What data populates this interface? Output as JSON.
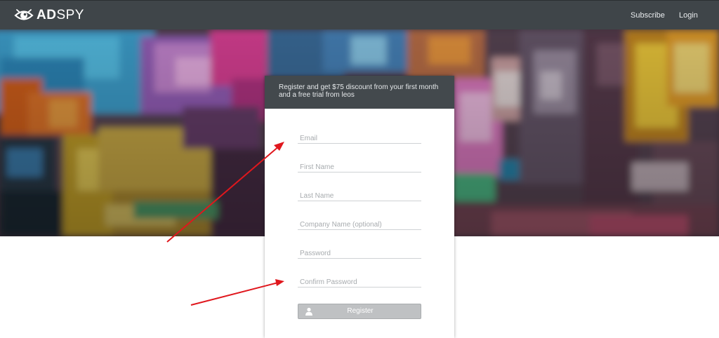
{
  "navbar": {
    "logo": {
      "icon": "eye-icon",
      "text_bold": "AD",
      "text_light": "SPY"
    },
    "links": {
      "subscribe": "Subscribe",
      "login": "Login"
    }
  },
  "hero": {
    "image": "blurred-city-billboards"
  },
  "register_card": {
    "header_line1": "Register and get $75 discount from your first month",
    "header_line2": "and a free trial from leos",
    "fields": {
      "email": {
        "value": "",
        "placeholder": "Email"
      },
      "first_name": {
        "value": "",
        "placeholder": "First Name"
      },
      "last_name": {
        "value": "",
        "placeholder": "Last Name"
      },
      "company_name": {
        "value": "",
        "placeholder": "Company Name (optional)"
      },
      "password": {
        "value": "",
        "placeholder": "Password"
      },
      "confirm_password": {
        "value": "",
        "placeholder": "Confirm Password"
      }
    },
    "register_button": {
      "icon": "user-icon",
      "label": "Register"
    }
  },
  "colors": {
    "navbar": "#3f4549",
    "card_header": "#43494d",
    "button": "#bfc1c3",
    "annotation_arrow": "#e0171d"
  }
}
